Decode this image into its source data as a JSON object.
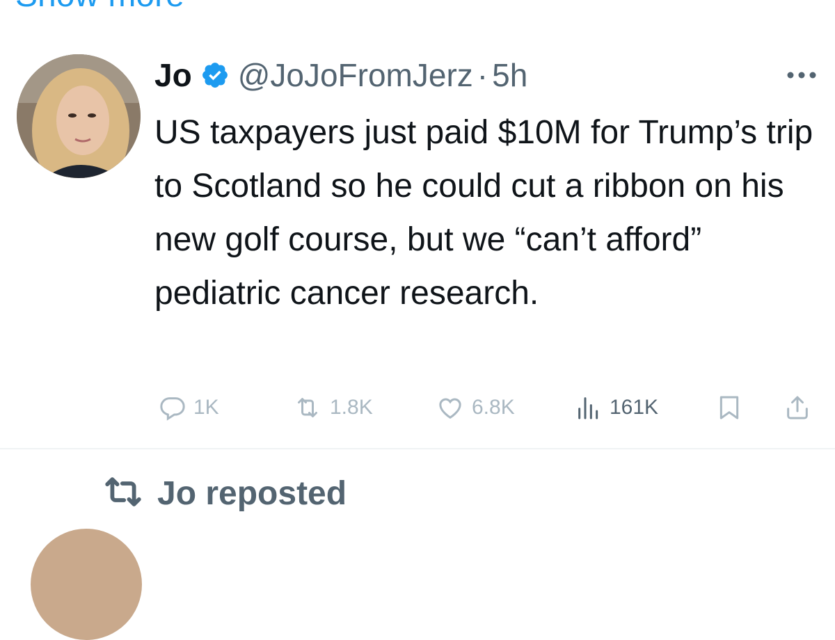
{
  "top": {
    "show_more_label": "Show more"
  },
  "tweet": {
    "author": {
      "name": "Jo",
      "handle": "@JoJoFromJerz",
      "separator": "·",
      "time": "5h",
      "verified": true
    },
    "more_icon": "more-horizontal-icon",
    "text": "US taxpayers just paid $10M for Trump’s trip to Scotland so he could cut a ribbon on his new golf course, but we “can’t afford” pediatric cancer research.",
    "actions": {
      "replies": "1K",
      "reposts": "1.8K",
      "likes": "6.8K",
      "views": "161K"
    }
  },
  "next": {
    "repost_label": "Jo reposted"
  },
  "colors": {
    "accent": "#1d9bf0",
    "text": "#0f1419",
    "secondary": "#536471",
    "faded": "#aab8c2",
    "divider": "#eff3f4"
  }
}
